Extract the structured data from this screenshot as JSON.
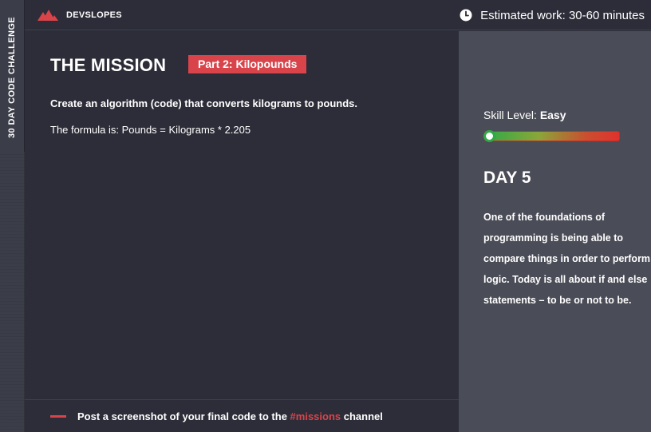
{
  "side": {
    "label": "30 DAY CODE CHALLENGE"
  },
  "header": {
    "brand": "DEVSLOPES",
    "estimate": "Estimated work: 30-60 minutes"
  },
  "mission": {
    "title": "THE MISSION",
    "part_badge": "Part 2: Kilopounds",
    "description": "Create an algorithm (code) that converts kilograms to pounds.",
    "formula": "The formula is:  Pounds = Kilograms * 2.205"
  },
  "footer": {
    "text_before": "Post a screenshot of your final code to the ",
    "highlight": "#missions",
    "text_after": " channel"
  },
  "panel": {
    "skill_label": "Skill Level: ",
    "skill_value": "Easy",
    "skill_level": 0.0,
    "day_title": "DAY 5",
    "day_text": "One of the foundations of programming is being able to compare things in order to perform logic. Today is all about if and else statements – to be or not to be."
  },
  "colors": {
    "accent": "#d9444b",
    "background": "#2c2d38",
    "panel": "#4a4c57",
    "skill_easy": "#2eaa47"
  },
  "icons": {
    "brand": "devslopes-logo-icon",
    "estimate": "clock-icon"
  }
}
